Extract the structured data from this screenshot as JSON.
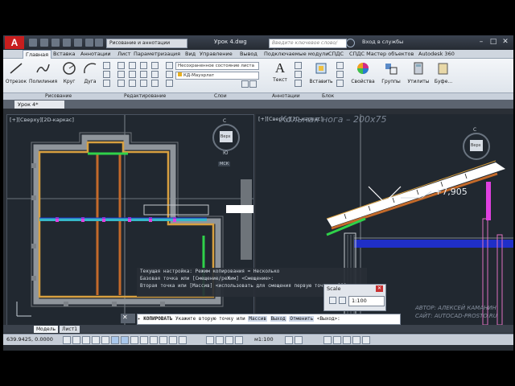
{
  "app": {
    "logo_letter": "A",
    "workspace": "Рисование и аннотации",
    "doc_title": "Урок 4.dwg",
    "search_placeholder": "Введите ключевое слово/фразу",
    "signin": "Вход в службы"
  },
  "ribbon": {
    "tabs": [
      "Главная",
      "Вставка",
      "Аннотации",
      "Лист",
      "Параметризация",
      "Вид",
      "Управление",
      "Вывод",
      "Подключаемые модули",
      "СПДС",
      "СПДС Мастер объектов",
      "Autodesk 360"
    ],
    "active_tab": "Главная",
    "draw_tools": [
      "Отрезок",
      "Полилиния",
      "Круг",
      "Дуга"
    ],
    "layer_state": "Несохраненное состояние листа",
    "layer_name": "КД-Мауэрлат",
    "annotation_tool": "Текст",
    "block_tool": "Вставить",
    "properties_tool": "Свойства",
    "groups_tool": "Группы",
    "utilities_tool": "Утилиты",
    "clipboard_tool": "Буфе...",
    "groups": [
      "Рисование",
      "Редактирование",
      "Слои",
      "Аннотации",
      "Блок"
    ]
  },
  "file_tab": "Урок 4*",
  "viewport_left": {
    "label": "[+][Сверху][2D-каркас]",
    "viewcube_top": "Верх",
    "compass_n": "С",
    "compass_s": "Ю",
    "ucs": "МСК"
  },
  "viewport_right": {
    "label": "[+][Сверху][2D-каркас]",
    "title_overlay": "Кольная нога – 200x75",
    "elevation": "+7,905",
    "viewcube_top": "Верх",
    "compass_n": "С"
  },
  "command": {
    "history": [
      "Текущая настройка: Режим копирования = Несколько",
      "Базовая точка или [Смещение/реЖим] <Смещение>:",
      "Вторая точка или [Массив] <использовать для смещения первую точку>: 800"
    ],
    "prompt_name": "КОПИРОВАТЬ",
    "prompt_text": "Укажите вторую точку или",
    "options": [
      "Массив",
      "Выход",
      "Отменить"
    ],
    "default": "<Выход>:"
  },
  "scale_dialog": {
    "title": "Scale",
    "value": "1:100"
  },
  "layout_tabs": [
    "Модель",
    "Лист1"
  ],
  "status": {
    "coords": "639.9425, 0.0000",
    "anno_scale": "м1:100"
  },
  "watermark": [
    "АВТОР: АЛЕКСЕЙ КАМАНИН",
    "САЙТ: AUTOCAD-PROSTO.RU"
  ],
  "colors": {
    "accent": "#c81e1e",
    "wall": "#9a9a9a",
    "beam": "#d8a040",
    "rafter": "#c46a2a",
    "green": "#2fd24a",
    "blue": "#1f2fc8",
    "magenta": "#e040e0",
    "cyan": "#36b8c8"
  }
}
